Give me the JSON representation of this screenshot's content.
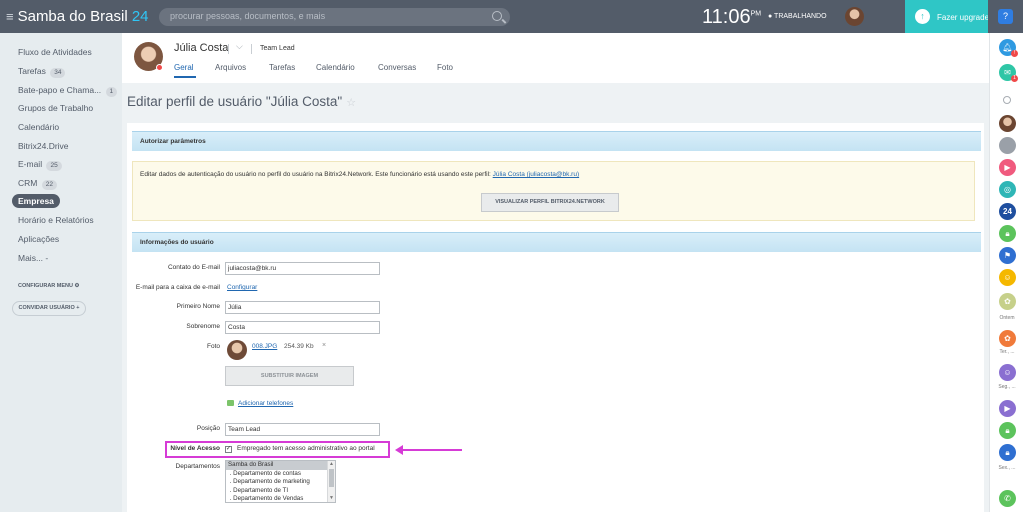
{
  "topbar": {
    "logo_text": "Samba do Brasil",
    "logo_num": "24",
    "search_placeholder": "procurar pessoas, documentos, e mais",
    "time": "11:06",
    "ampm": "PM",
    "work_status": "TRABALHANDO",
    "upgrade_label": "Fazer upgrade",
    "help": "?"
  },
  "leftmenu": {
    "items": [
      {
        "label": "Fluxo de Atividades",
        "count": ""
      },
      {
        "label": "Tarefas",
        "count": "34"
      },
      {
        "label": "Bate-papo e Chama...",
        "count": "1"
      },
      {
        "label": "Grupos de Trabalho",
        "count": ""
      },
      {
        "label": "Calendário",
        "count": ""
      },
      {
        "label": "Bitrix24.Drive",
        "count": ""
      },
      {
        "label": "E-mail",
        "count": "25"
      },
      {
        "label": "CRM",
        "count": "22"
      },
      {
        "label": "Empresa",
        "count": ""
      },
      {
        "label": "Horário e Relatórios",
        "count": ""
      },
      {
        "label": "Aplicações",
        "count": ""
      },
      {
        "label": "Mais... -",
        "count": ""
      }
    ],
    "configure_menu": "CONFIGURAR MENU",
    "invite_user": "CONVIDAR USUÁRIO"
  },
  "profile": {
    "name": "Júlia Costa",
    "role": "Team Lead",
    "tabs": [
      "Geral",
      "Arquivos",
      "Tarefas",
      "Calendário",
      "Conversas",
      "Foto"
    ]
  },
  "page_title": "Editar perfil de usuário \"Júlia Costa\"",
  "auth_section": {
    "title": "Autorizar parâmetros",
    "notice_text": "Editar dados de autenticação do usuário no perfil do usuário na Bitrix24.Network. Este funcionário está usando este perfil:",
    "notice_link": "Júlia Costa (juliacosta@bk.ru)",
    "button": "VISUALIZAR PERFIL BITRIX24.NETWORK"
  },
  "user_info": {
    "title": "Informações do usuário",
    "contact_email_label": "Contato do E-mail",
    "contact_email": "juliacosta@bk.ru",
    "mailbox_label": "E-mail para a caixa de e-mail",
    "mailbox_link": "Configurar",
    "first_name_label": "Primeiro Nome",
    "first_name": "Júlia",
    "last_name_label": "Sobrenome",
    "last_name": "Costa",
    "photo_label": "Foto",
    "photo_file": "008.JPG",
    "photo_size": "254.39 Kb",
    "photo_delete": "×",
    "replace_image": "SUBSTITUIR IMAGEM",
    "add_phones": "Adicionar telefones",
    "position_label": "Posição",
    "position": "Team Lead",
    "access_label": "Nível de Acesso",
    "access_check": "Empregado tem acesso administrativo ao portal",
    "departments_label": "Departamentos",
    "departments": [
      "Samba do Brasil",
      " . Departamento de contas",
      " . Departamento de marketing",
      " . Departamento de TI",
      " . Departamento de Vendas"
    ]
  },
  "rightbar": {
    "labels": [
      "Ontem",
      "Ter., ...",
      "Seg., ...",
      "Sex., ..."
    ]
  },
  "colors": {
    "topbar": "#535c69",
    "accent": "#2fc6c6",
    "link": "#2067b0",
    "highlight": "#d63bd6"
  }
}
